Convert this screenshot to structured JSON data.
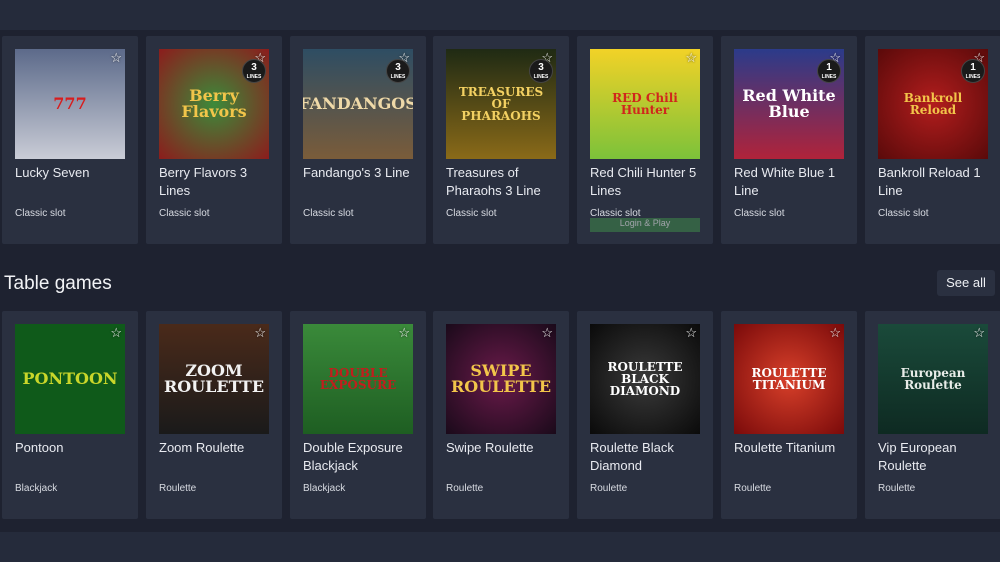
{
  "slots": [
    {
      "title": "Lucky Seven",
      "category": "Classic slot",
      "art": "777",
      "bg": "linear-gradient(#5c6a8a,#c9ccd6)",
      "fg": "#d81d1d",
      "lines": ""
    },
    {
      "title": "Berry Flavors 3 Lines",
      "category": "Classic slot",
      "art": "Berry Flavors",
      "bg": "radial-gradient(#3c8a3a,#8c1c1c)",
      "fg": "#f2c54a",
      "lines": "3"
    },
    {
      "title": "Fandango's 3 Line",
      "category": "Classic slot",
      "art": "FANDANGOS",
      "bg": "linear-gradient(#2e4d63,#7a5c3a)",
      "fg": "#efd9a8",
      "lines": "3"
    },
    {
      "title": "Treasures of Pharaohs 3 Line",
      "category": "Classic slot",
      "art": "TREASURES OF PHARAOHS",
      "bg": "linear-gradient(#1f2a14,#8a6a18)",
      "fg": "#f3d162",
      "lines": "3"
    },
    {
      "title": "Red Chili Hunter 5 Lines",
      "category": "Classic slot",
      "art": "RED Chili Hunter",
      "bg": "linear-gradient(#f2d227,#7cc23a)",
      "fg": "#d0261c",
      "lines": ""
    },
    {
      "title": "Red White Blue 1 Line",
      "category": "Classic slot",
      "art": "Red White Blue",
      "bg": "linear-gradient(#2b3b8a,#b0233a)",
      "fg": "#ffffff",
      "lines": "1"
    },
    {
      "title": "Bankroll Reload 1 Line",
      "category": "Classic slot",
      "art": "Bankroll Reload",
      "bg": "radial-gradient(#b21d1d,#5a0a0a)",
      "fg": "#f2c54a",
      "lines": "1"
    }
  ],
  "lines_caption": "LINES",
  "hover_label": "Login & Play",
  "section": {
    "title": "Table games",
    "see_all": "See all"
  },
  "table_games": [
    {
      "title": "Pontoon",
      "category": "Blackjack",
      "art": "PONTOON",
      "bg": "#0f5a1a",
      "fg": "#c9d62a"
    },
    {
      "title": "Zoom Roulette",
      "category": "Roulette",
      "art": "ZOOM ROULETTE",
      "bg": "linear-gradient(#4a2a1a,#1a1a1a)",
      "fg": "#f2f2f2"
    },
    {
      "title": "Double Exposure Blackjack",
      "category": "Blackjack",
      "art": "DOUBLE EXPOSURE",
      "bg": "linear-gradient(#3a8a3a,#1e5e22)",
      "fg": "#c21d1d"
    },
    {
      "title": "Swipe Roulette",
      "category": "Roulette",
      "art": "SWIPE ROULETTE",
      "bg": "radial-gradient(#6a1a4a,#1a0a1a)",
      "fg": "#f2c54a"
    },
    {
      "title": "Roulette Black Diamond",
      "category": "Roulette",
      "art": "ROULETTE BLACK DIAMOND",
      "bg": "radial-gradient(#3a3a3a,#0a0a0a)",
      "fg": "#ffffff"
    },
    {
      "title": "Roulette Titanium",
      "category": "Roulette",
      "art": "ROULETTE TITANIUM",
      "bg": "radial-gradient(#d8402a,#7a0a0a)",
      "fg": "#ffffff"
    },
    {
      "title": "Vip European Roulette",
      "category": "Roulette",
      "art": "European Roulette",
      "bg": "linear-gradient(#1a4a3a,#0e2a22)",
      "fg": "#e8ece8"
    }
  ]
}
